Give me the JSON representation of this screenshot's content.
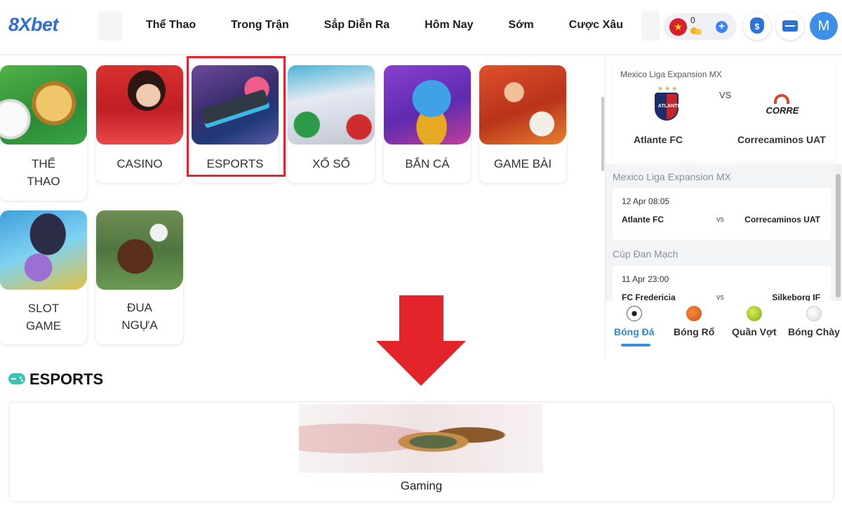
{
  "header": {
    "logo": {
      "prefix": "8X",
      "suffix": "bet"
    },
    "nav": [
      "Thể Thao",
      "Trong Trận",
      "Sắp Diễn Ra",
      "Hôm Nay",
      "Sớm",
      "Cược Xâu"
    ],
    "wallet": {
      "balance": "0",
      "flag_icon": "vietnam-flag-icon",
      "coin_icon": "coins-icon"
    },
    "avatar_initial": "M"
  },
  "games": [
    {
      "label": "THỂ\nTHAO",
      "icon": "sports-game-icon"
    },
    {
      "label": "CASINO",
      "icon": "casino-game-icon"
    },
    {
      "label": "ESPORTS",
      "icon": "esports-game-icon"
    },
    {
      "label": "XỔ SỐ",
      "icon": "lottery-game-icon"
    },
    {
      "label": "BẮN CÁ",
      "icon": "fishing-game-icon"
    },
    {
      "label": "GAME BÀI",
      "icon": "card-game-icon"
    },
    {
      "label": "SLOT\nGAME",
      "icon": "slot-game-icon"
    },
    {
      "label": "ĐUA\nNGỰA",
      "icon": "horse-racing-icon"
    }
  ],
  "featured_match": {
    "league": "Mexico Liga Expansion MX",
    "vs": "VS",
    "home": "Atlante FC",
    "away": "Correcaminos UAT",
    "home_crest_text": "ATLANTE",
    "away_crest_text": "CORRE"
  },
  "matches": [
    {
      "league": "Mexico Liga Expansion MX",
      "datetime": "12 Apr  08:05",
      "home": "Atlante FC",
      "vs": "vs",
      "away": "Correcaminos UAT"
    },
    {
      "league": "Cúp Đan Mạch",
      "datetime": "11 Apr  23:00",
      "home": "FC Fredericia",
      "vs": "vs",
      "away": "Silkeborg IF"
    }
  ],
  "sports_tabs": [
    {
      "label": "Bóng Đá",
      "icon": "soccer-ball-icon",
      "active": true
    },
    {
      "label": "Bóng Rổ",
      "icon": "basketball-icon",
      "active": false
    },
    {
      "label": "Quần Vợt",
      "icon": "tennis-ball-icon",
      "active": false
    },
    {
      "label": "Bóng Chày",
      "icon": "baseball-icon",
      "active": false
    }
  ],
  "section": {
    "title": "ESPORTS",
    "icon": "gamepad-icon"
  },
  "banner": {
    "caption": "Gaming"
  },
  "colors": {
    "brand": "#2c6fd6",
    "highlight": "#e3242b",
    "active_tab": "#2f8ad8",
    "esports_icon": "#3cc2b0"
  }
}
